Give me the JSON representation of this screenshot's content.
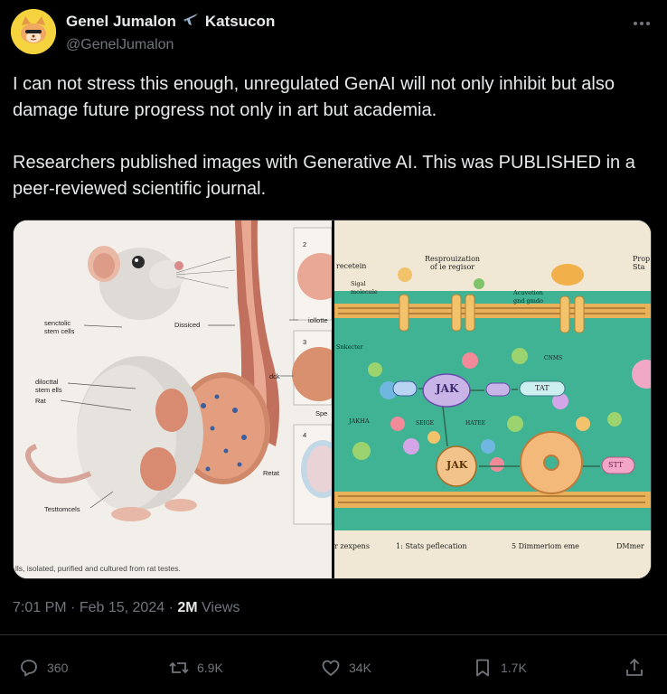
{
  "author": {
    "display_name": "Genel Jumalon",
    "name_suffix": "Katsucon",
    "handle": "@GenelJumalon"
  },
  "tweet": {
    "text": "I can not stress this enough, unregulated GenAI will not only inhibit but also damage future progress not only in art but academia.\n\nResearchers published images with Generative AI. This was PUBLISHED in a peer-reviewed scientific journal."
  },
  "image_left": {
    "labels": {
      "senctolic": "senctolic\nstem cells",
      "dissiced": "Dissiced",
      "iollotte": "iollotte",
      "dck": "dck",
      "diloctal": "dilocttal\nstem ells",
      "rat": "Rat",
      "retat": "Retat",
      "testomcels": "Testtomcels",
      "spe": "Spe",
      "n2": "2",
      "n3": "3",
      "n4": "4"
    },
    "caption": "lls, isolated, purified and cultured from rat testes."
  },
  "image_right": {
    "labels": {
      "recetein": "recetein",
      "resprouization": "Resprouization\nof ie regisor",
      "prop": "Prop\nSta",
      "sigal": "Sigal\nmolecule",
      "activation": "Acuvetion\ngnd gmdo",
      "senkecter": "Snkecter",
      "jak_main": "JAK",
      "jak_lower": "JAK",
      "tat": "TAT",
      "jakha": "JAKHA",
      "seige": "SEIGE",
      "matee": "HATEE",
      "cnms": "CNMS",
      "stt": "STT",
      "bottom1": "r zexpens",
      "bottom2": "1: Stats peflecation",
      "bottom3": "5 Dimmeriom eme",
      "bottom4": "DMmer"
    }
  },
  "meta": {
    "time": "7:01 PM",
    "dot1": "·",
    "date": "Feb 15, 2024",
    "dot2": "·",
    "views_count": "2M",
    "views_label": "Views"
  },
  "actions": {
    "replies": "360",
    "reposts": "6.9K",
    "likes": "34K",
    "bookmarks": "1.7K"
  },
  "colors": {
    "background": "#000000",
    "text_primary": "#e7e9ea",
    "text_secondary": "#71767b",
    "border": "#2f3336",
    "cell_green": "#3fb393"
  }
}
